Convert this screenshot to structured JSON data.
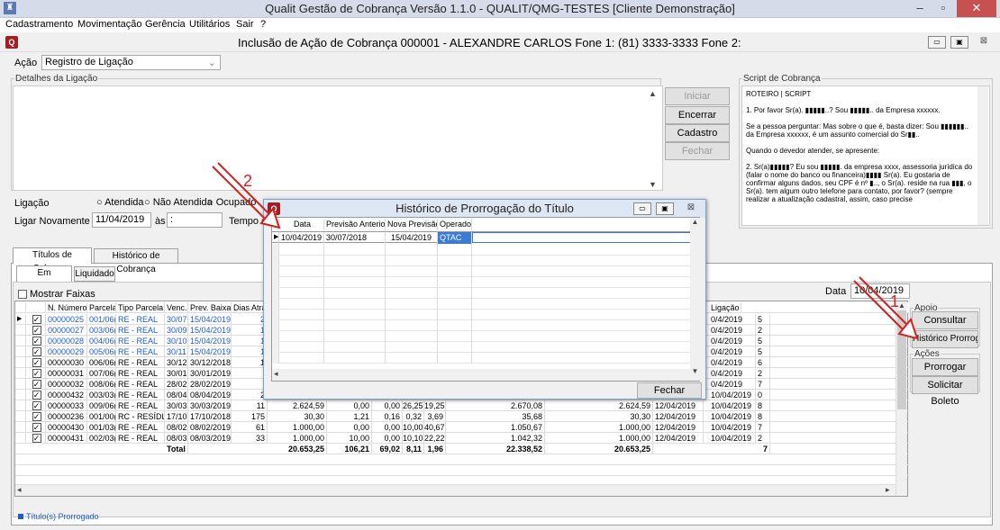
{
  "window": {
    "title": "Qualit Gestão de Cobrança Versão 1.1.0 - QUALIT/QMG-TESTES [Cliente Demonstração]",
    "min": "–",
    "max": "▫",
    "close": "✕"
  },
  "menu": [
    "Cadastramento",
    "Movimentação",
    "Gerência",
    "Utilitários",
    "Sair",
    "?"
  ],
  "inner": {
    "title": "Inclusão de Ação de Cobrança    000001 - ALEXANDRE CARLOS  Fone 1: (81) 3333-3333 Fone 2:",
    "btn_min": "▭",
    "btn_max": "▣",
    "btn_close": "⊠"
  },
  "acao": {
    "label": "Ação",
    "value": "Registro de Ligação",
    "dropdown_icon": "chevron-down"
  },
  "detalhes": {
    "legend": "Detalhes da Ligação",
    "text": ""
  },
  "actions": {
    "iniciar": "Iniciar Ligação",
    "encerrar": "Encerrar Ligação",
    "cadastro": "Cadastro",
    "fechar": "Fechar"
  },
  "script": {
    "legend": "Script de Cobrança",
    "title": "ROTEIRO | SCRIPT",
    "p1": "1. Por favor Sr(a). ▮▮▮▮▮..? Sou ▮▮▮▮▮.. da Empresa xxxxxx.",
    "p2": "Se a pessoa perguntar: Mas sobre o que é, basta dizer: Sou ▮▮▮▮▮▮.. da Empresa xxxxxx, é um assunto comercial do Sr▮▮..",
    "p3": "Quando o devedor atender, se apresente:",
    "p4": "2. Sr(a)▮▮▮▮▮? Eu sou ▮▮▮▮▮. da empresa xxxx, assessoria jurídica do (falar o nome do banco ou financeira)▮▮▮▮ Sr(a). Eu gostaria de confirmar alguns dados, seu CPF é nº ▮.., o Sr(a). reside na rua ▮▮▮, o Sr(a). tem algum outro telefone para contato, por favor? (sempre realizar a atualização cadastral, assim, caso precise"
  },
  "ligacao": {
    "label": "Ligação",
    "options": [
      "Atendida",
      "Não Atendida",
      "Ocupado"
    ],
    "ligar_label": "Ligar Novamente em:",
    "ligar_date": "11/04/2019",
    "as_label": "às",
    "as_value": ":",
    "tempo_label": "Tempo em"
  },
  "tabs": {
    "titulos": "Títulos de Cobrança",
    "historico": "Histórico de Cobrança",
    "em_cobranca": "Em Cobrança",
    "liquidado": "Liquidado"
  },
  "filters": {
    "mostrar_faixas": "Mostrar Faixas",
    "data_label": "Data",
    "data_value": "10/04/2019"
  },
  "grid": {
    "headers": [
      "N. Número",
      "Parcela",
      "Tipo Parcela",
      "Venc.",
      "Prev. Baixa",
      "Dias Atra"
    ],
    "right_header": "Ligação Vi",
    "rows": [
      {
        "checked": true,
        "blue": true,
        "num": "00000025",
        "parcela": "001/06(",
        "tipo": "RE - REAL",
        "venc": "30/07",
        "prev": "15/04/2019",
        "dias": "2",
        "c1": "",
        "c2": "",
        "c3": "",
        "c4": "",
        "c5": "",
        "c6": "",
        "c7": "",
        "c8": "",
        "c9": "",
        "lig": "0/4/2019",
        "v": "5"
      },
      {
        "checked": true,
        "blue": true,
        "num": "00000027",
        "parcela": "003/06(",
        "tipo": "RE - REAL",
        "venc": "30/09",
        "prev": "15/04/2019",
        "dias": "1",
        "c1": "",
        "c2": "",
        "c3": "",
        "c4": "",
        "c5": "",
        "c6": "",
        "c7": "",
        "c8": "",
        "c9": "",
        "lig": "0/4/2019",
        "v": "2"
      },
      {
        "checked": true,
        "blue": true,
        "num": "00000028",
        "parcela": "004/06(",
        "tipo": "RE - REAL",
        "venc": "30/10",
        "prev": "15/04/2019",
        "dias": "1",
        "c1": "",
        "c2": "",
        "c3": "",
        "c4": "",
        "c5": "",
        "c6": "",
        "c7": "",
        "c8": "",
        "c9": "",
        "lig": "0/4/2019",
        "v": "5"
      },
      {
        "checked": true,
        "blue": true,
        "num": "00000029",
        "parcela": "005/06(",
        "tipo": "RE - REAL",
        "venc": "30/11",
        "prev": "15/04/2019",
        "dias": "1",
        "c1": "",
        "c2": "",
        "c3": "",
        "c4": "",
        "c5": "",
        "c6": "",
        "c7": "",
        "c8": "",
        "c9": "",
        "lig": "0/4/2019",
        "v": "5"
      },
      {
        "checked": true,
        "blue": false,
        "num": "00000030",
        "parcela": "006/06(",
        "tipo": "RE - REAL",
        "venc": "30/12",
        "prev": "30/12/2018",
        "dias": "1",
        "c1": "",
        "c2": "",
        "c3": "",
        "c4": "",
        "c5": "",
        "c6": "",
        "c7": "",
        "c8": "",
        "c9": "",
        "lig": "0/4/2019",
        "v": "6"
      },
      {
        "checked": true,
        "blue": false,
        "num": "00000031",
        "parcela": "007/06(",
        "tipo": "RE - REAL",
        "venc": "30/01",
        "prev": "30/01/2019",
        "dias": "",
        "c1": "",
        "c2": "",
        "c3": "",
        "c4": "",
        "c5": "",
        "c6": "",
        "c7": "",
        "c8": "",
        "c9": "",
        "lig": "0/4/2019",
        "v": "2"
      },
      {
        "checked": true,
        "blue": false,
        "num": "00000032",
        "parcela": "008/06(",
        "tipo": "RE - REAL",
        "venc": "28/02",
        "prev": "28/02/2019",
        "dias": "",
        "c1": "",
        "c2": "",
        "c3": "",
        "c4": "",
        "c5": "",
        "c6": "",
        "c7": "",
        "c8": "",
        "c9": "",
        "lig": "0/4/2019",
        "v": "7"
      },
      {
        "checked": true,
        "blue": false,
        "num": "00000432",
        "parcela": "003/03(",
        "tipo": "RE - REAL",
        "venc": "08/04",
        "prev": "08/04/2019",
        "dias": "2",
        "c1": "1.000,00",
        "c2": "20,00",
        "c3": "0,00",
        "c4": "0,00",
        "c5": "0,00",
        "c6": "1.020,00",
        "c7": "1.000,00",
        "c8": "12/04/2019",
        "c9": "",
        "lig": "10/04/2019",
        "v": "0"
      },
      {
        "checked": true,
        "blue": false,
        "num": "00000033",
        "parcela": "009/06(",
        "tipo": "RE - REAL",
        "venc": "30/03",
        "prev": "30/03/2019",
        "dias": "11",
        "c1": "2.624,59",
        "c2": "0,00",
        "c3": "0,00",
        "c4": "26,25",
        "c5": "19,25",
        "c6": "2.670,08",
        "c7": "2.624,59",
        "c8": "12/04/2019",
        "c9": "",
        "lig": "10/04/2019",
        "v": "8"
      },
      {
        "checked": true,
        "blue": false,
        "num": "00000236",
        "parcela": "001/00(",
        "tipo": "RC - RESÍDL",
        "venc": "17/10",
        "prev": "17/10/2018",
        "dias": "175",
        "c1": "30,30",
        "c2": "1,21",
        "c3": "0,16",
        "c4": "0,32",
        "c5": "3,69",
        "c6": "35,68",
        "c7": "30,30",
        "c8": "12/04/2019",
        "c9": "",
        "lig": "10/04/2019",
        "v": "8"
      },
      {
        "checked": true,
        "blue": false,
        "num": "00000430",
        "parcela": "001/03(",
        "tipo": "RE - REAL",
        "venc": "08/02",
        "prev": "08/02/2019",
        "dias": "61",
        "c1": "1.000,00",
        "c2": "0,00",
        "c3": "0,00",
        "c4": "10,00",
        "c5": "40,67",
        "c6": "1.050,67",
        "c7": "1.000,00",
        "c8": "12/04/2019",
        "c9": "",
        "lig": "10/04/2019",
        "v": "7"
      },
      {
        "checked": true,
        "blue": false,
        "num": "00000431",
        "parcela": "002/03(",
        "tipo": "RE - REAL",
        "venc": "08/03",
        "prev": "08/03/2019",
        "dias": "33",
        "c1": "1.000,00",
        "c2": "10,00",
        "c3": "0,00",
        "c4": "10,10",
        "c5": "22,22",
        "c6": "1.042,32",
        "c7": "1.000,00",
        "c8": "12/04/2019",
        "c9": "",
        "lig": "10/04/2019",
        "v": "2"
      }
    ],
    "total": {
      "label": "Total",
      "c1": "20.653,25",
      "c2": "106,21",
      "c3": "69,02",
      "c4": "8,11",
      "c5": "1,96",
      "c6": "22.338,52",
      "c7": "20.653,25",
      "v": "7"
    }
  },
  "apoio": {
    "legend": "Apoio",
    "consultar": "Consultar Título",
    "historico": "Histórico Prorrogaç"
  },
  "acoes": {
    "legend": "Ações",
    "prorrogar": "Prorrogar Títulos",
    "solicitar": "Solicitar Boleto"
  },
  "footer": {
    "legend_text": "Título(s) Prorrogado"
  },
  "popup": {
    "title": "Histórico de Prorrogação do Título",
    "headers": [
      "Data",
      "Previsão Anterior",
      "Nova Previsão",
      "Operador"
    ],
    "rows": [
      {
        "data": "10/04/2019",
        "prev_ant": "30/07/2018",
        "nova": "15/04/2019",
        "operador": "QTAC"
      }
    ],
    "fechar": "Fechar"
  },
  "annotations": {
    "one": "1",
    "two": "2",
    "color": "#d42020"
  },
  "colors": {
    "accent_blue": "#1e5ccc",
    "brand_red": "#a31e22",
    "close_red": "#c75050"
  }
}
